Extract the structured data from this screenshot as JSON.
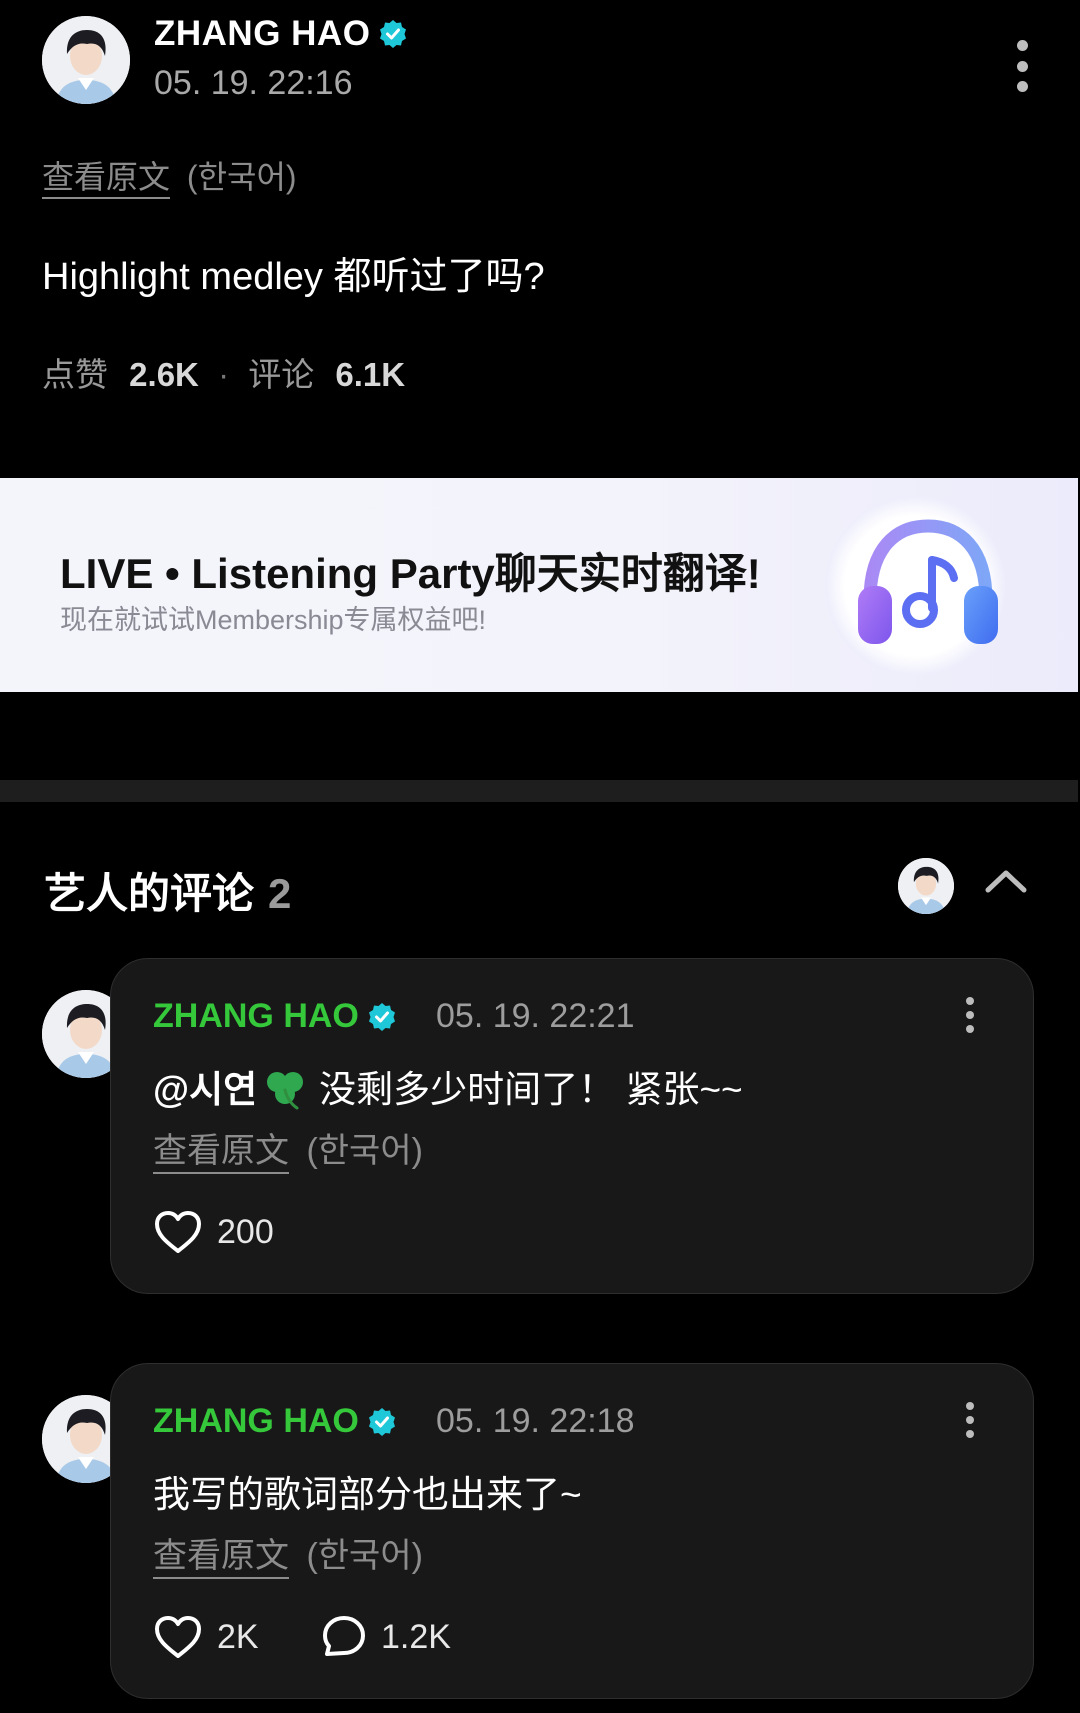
{
  "post": {
    "author": "ZHANG HAO",
    "timestamp": "05. 19. 22:16",
    "translate_link": "查看原文",
    "translate_lang": "(한국어)",
    "body": "Highlight medley 都听过了吗?",
    "likes_label": "点赞",
    "likes_count": "2.6K",
    "separator": "·",
    "comments_label": "评论",
    "comments_count": "6.1K"
  },
  "banner": {
    "title": "LIVE • Listening Party聊天实时翻译!",
    "subtitle": "现在就试试Membership专属权益吧!",
    "icon": "headphones-music-icon"
  },
  "artist_comments": {
    "title": "艺人的评论",
    "count": "2",
    "items": [
      {
        "author": "ZHANG HAO",
        "timestamp": "05. 19. 22:21",
        "mention": "@시연",
        "emoji": "☘️",
        "text": "没剩多少时间了！ 紧张~~",
        "translate_link": "查看原文",
        "translate_lang": "(한국어)",
        "likes": "200"
      },
      {
        "author": "ZHANG HAO",
        "timestamp": "05. 19. 22:18",
        "text": "我写的歌词部分也出来了~",
        "translate_link": "查看原文",
        "translate_lang": "(한국어)",
        "likes": "2K",
        "replies": "1.2K"
      }
    ]
  },
  "colors": {
    "background": "#000000",
    "verified_badge": "#1fc8d8",
    "comment_author": "#35c83b",
    "card_background": "#181818",
    "banner_background": "#f4f4fb",
    "headphone_purple": "#8f5cf0",
    "headphone_blue": "#4f7cf6"
  }
}
